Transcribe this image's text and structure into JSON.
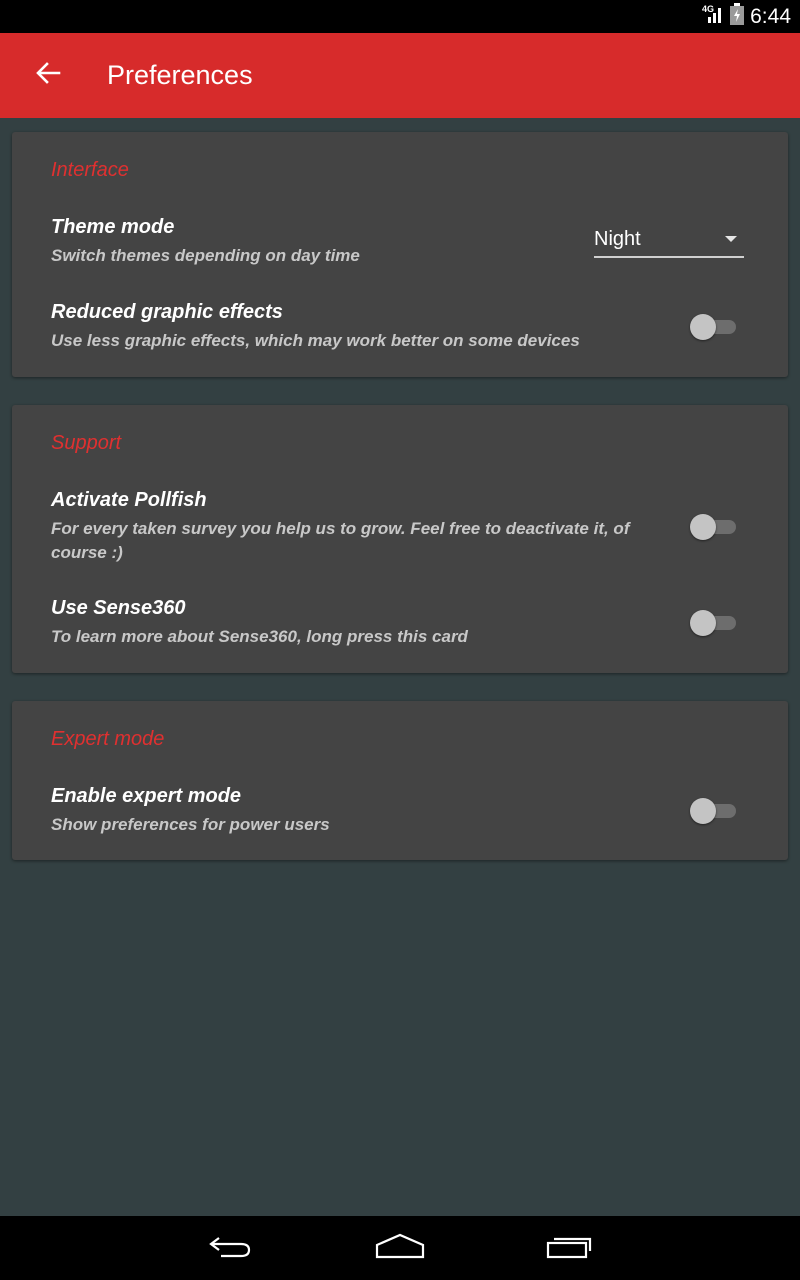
{
  "status_bar": {
    "network": "4G",
    "time": "6:44",
    "icons": [
      "signal-icon",
      "battery-icon"
    ]
  },
  "toolbar": {
    "title": "Preferences",
    "back_icon": "arrow-back-icon",
    "color": "#d72b2b"
  },
  "sections": {
    "interface": {
      "header": "Interface",
      "theme_mode": {
        "title": "Theme mode",
        "summary": "Switch themes depending on day time",
        "value": "Night"
      },
      "reduced_effects": {
        "title": "Reduced graphic effects",
        "summary": "Use less graphic effects, which may work better on some devices",
        "enabled": false
      }
    },
    "support": {
      "header": "Support",
      "pollfish": {
        "title": "Activate Pollfish",
        "summary": "For every taken survey you help us to grow. Feel free to deactivate it, of course :)",
        "enabled": false
      },
      "sense360": {
        "title": "Use Sense360",
        "summary": "To learn more about Sense360, long press this card",
        "enabled": false
      }
    },
    "expert": {
      "header": "Expert mode",
      "expert_mode": {
        "title": "Enable expert mode",
        "summary": "Show preferences for power users",
        "enabled": false
      }
    }
  },
  "nav_bar": {
    "icons": [
      "back-icon",
      "home-icon",
      "recents-icon"
    ]
  },
  "colors": {
    "accent": "#e03030",
    "background": "#334042",
    "card": "#444444"
  }
}
